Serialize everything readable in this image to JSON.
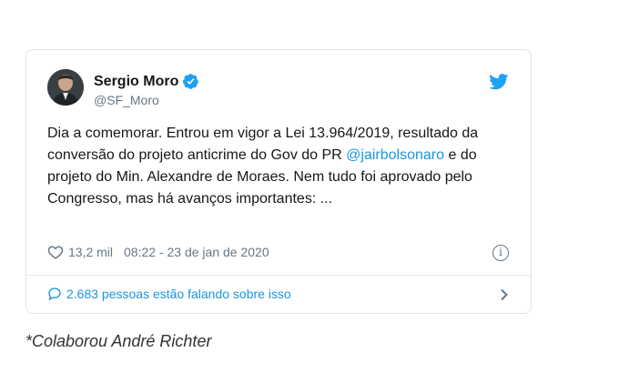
{
  "tweet": {
    "author_name": "Sergio Moro",
    "author_handle": "@SF_Moro",
    "text_part1": "Dia a comemorar. Entrou em vigor a Lei 13.964/2019, resultado da conversão do projeto anticrime do Gov do PR ",
    "mention": "@jairbolsonaro",
    "text_part2": " e do projeto do Min. Alexandre de Moraes. Nem tudo foi aprovado pelo Congresso, mas há avanços importantes: ...",
    "likes": "13,2 mil",
    "timestamp": "08:22 - 23 de jan de 2020",
    "conversation": "2.683 pessoas estão falando sobre isso",
    "info_glyph": "i"
  },
  "credit": "*Colaborou André Richter",
  "icons": [
    "verified-icon",
    "twitter-bird-icon",
    "heart-icon",
    "info-icon",
    "comment-bubble-icon",
    "chevron-right-icon"
  ],
  "colors": {
    "accent": "#1b95e0",
    "verified": "#1da1f2",
    "muted": "#657786",
    "text": "#14171a"
  }
}
